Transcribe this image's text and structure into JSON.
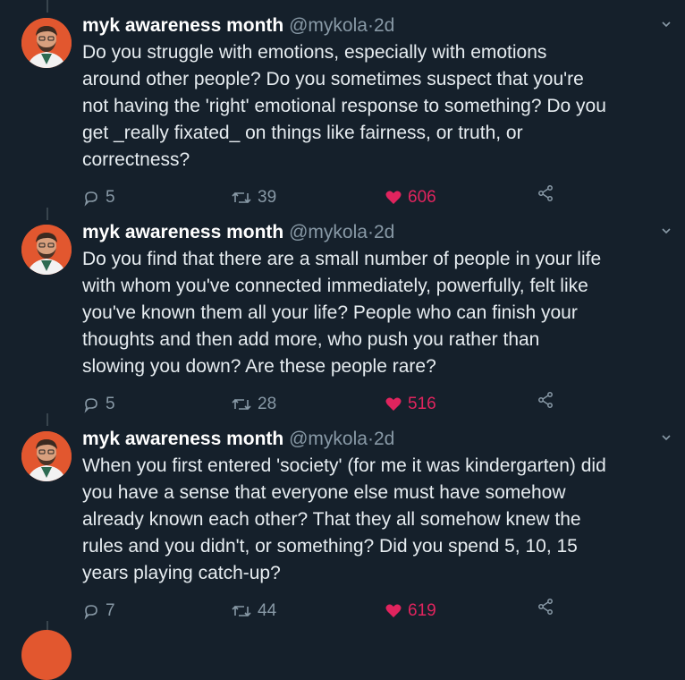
{
  "tweets": [
    {
      "name": "myk awareness month",
      "handle": "@mykola",
      "dot": "·",
      "time": "2d",
      "text_lines": [
        "Do you struggle with emotions, especially with emotions",
        "around other people? Do you sometimes suspect that you're",
        "not having the 'right' emotional response to something? Do you",
        "get _really fixated_ on things like fairness, or truth, or",
        "correctness?"
      ],
      "replies": "5",
      "retweets": "39",
      "likes": "606"
    },
    {
      "name": "myk awareness month",
      "handle": "@mykola",
      "dot": "·",
      "time": "2d",
      "text_lines": [
        "Do you find that there are a small number of people in your life",
        "with whom you've connected immediately, powerfully, felt like",
        "you've known them all your life? People who can finish your",
        "thoughts and then add more, who push you rather than",
        "slowing you down? Are these people rare?"
      ],
      "replies": "5",
      "retweets": "28",
      "likes": "516"
    },
    {
      "name": "myk awareness month",
      "handle": "@mykola",
      "dot": "·",
      "time": "2d",
      "text_lines": [
        "When you first entered 'society' (for me it was kindergarten) did",
        "you have a sense that everyone else must have somehow",
        "already known each other? That they all somehow knew the",
        "rules and you didn't, or something? Did you spend 5, 10, 15",
        "years playing catch-up?"
      ],
      "replies": "7",
      "retweets": "44",
      "likes": "619"
    }
  ],
  "icons": {
    "reply": "reply-icon",
    "retweet": "retweet-icon",
    "like": "heart-icon",
    "share": "share-icon",
    "caret": "chevron-down-icon",
    "avatar": "avatar"
  },
  "colors": {
    "background": "#15202b",
    "text": "#e6ecf0",
    "muted": "#8899a6",
    "like": "#e0245e",
    "avatar_bg": "#e2572f"
  }
}
